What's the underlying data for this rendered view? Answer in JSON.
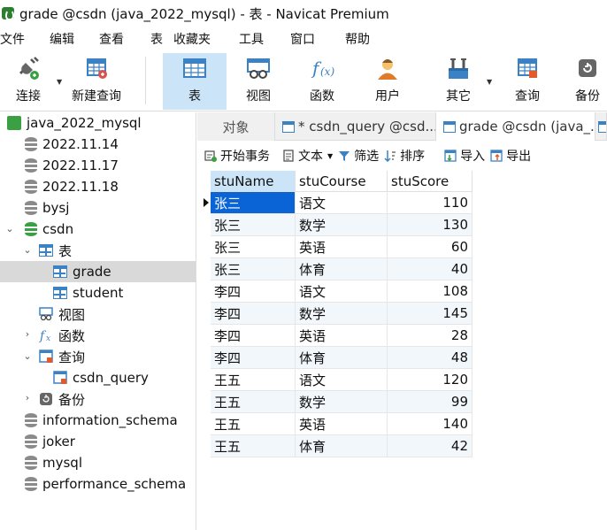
{
  "window": {
    "title": "grade @csdn (java_2022_mysql) - 表 - Navicat Premium"
  },
  "menu": [
    "文件",
    "编辑",
    "查看",
    "表",
    "收藏夹",
    "工具",
    "窗口",
    "帮助"
  ],
  "toolbar": {
    "connect": "连接",
    "new_query": "新建查询",
    "table": "表",
    "view": "视图",
    "function": "函数",
    "user": "用户",
    "other": "其它",
    "query": "查询",
    "backup": "备份"
  },
  "tree": {
    "connection": "java_2022_mysql",
    "databases_top": [
      "2022.11.14",
      "2022.11.17",
      "2022.11.18",
      "bysj"
    ],
    "csdn": "csdn",
    "tables_group": "表",
    "tables": [
      "grade",
      "student"
    ],
    "views_group": "视图",
    "functions_group": "函数",
    "queries_group": "查询",
    "queries": [
      "csdn_query"
    ],
    "backups_group": "备份",
    "databases_bottom": [
      "information_schema",
      "joker",
      "mysql",
      "performance_schema"
    ]
  },
  "tabs": {
    "objects": "对象",
    "query_tab": "* csdn_query @csd...",
    "grade_tab": "grade @csdn (java_..."
  },
  "actions": {
    "begin_transaction": "开始事务",
    "text": "文本",
    "filter": "筛选",
    "sort": "排序",
    "import": "导入",
    "export": "导出"
  },
  "grid": {
    "columns": [
      "stuName",
      "stuCourse",
      "stuScore"
    ],
    "rows": [
      [
        "张三",
        "语文",
        "110"
      ],
      [
        "张三",
        "数学",
        "130"
      ],
      [
        "张三",
        "英语",
        "60"
      ],
      [
        "张三",
        "体育",
        "40"
      ],
      [
        "李四",
        "语文",
        "108"
      ],
      [
        "李四",
        "数学",
        "145"
      ],
      [
        "李四",
        "英语",
        "28"
      ],
      [
        "李四",
        "体育",
        "48"
      ],
      [
        "王五",
        "语文",
        "120"
      ],
      [
        "王五",
        "数学",
        "99"
      ],
      [
        "王五",
        "英语",
        "140"
      ],
      [
        "王五",
        "体育",
        "42"
      ]
    ]
  },
  "colors": {
    "accent": "#0a64d6",
    "selected_tab": "#cce4f7",
    "db_green": "#3aa043",
    "table_blue": "#3b82c4"
  }
}
